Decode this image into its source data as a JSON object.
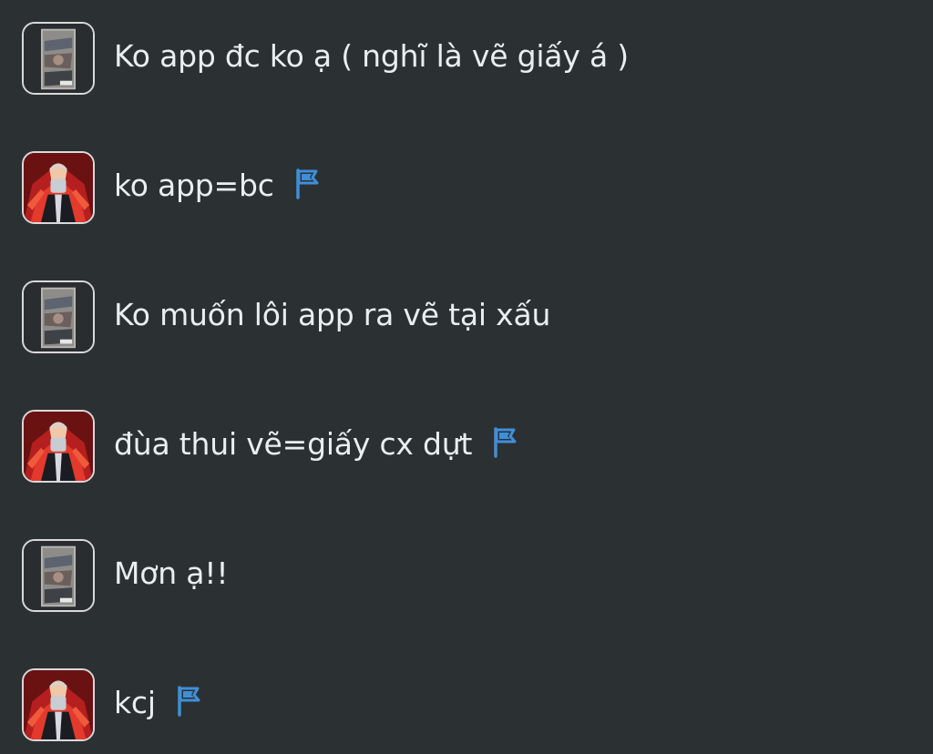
{
  "messages": [
    {
      "author": "user-a",
      "avatar": "sketch-avatar",
      "text": "Ko app đc ko ạ ( nghĩ là vẽ giấy á )",
      "flag": false
    },
    {
      "author": "user-b",
      "avatar": "hero-avatar",
      "text": "ko app=bc",
      "flag": true
    },
    {
      "author": "user-a",
      "avatar": "sketch-avatar",
      "text": "Ko muốn lôi app ra vẽ tại xấu",
      "flag": false
    },
    {
      "author": "user-b",
      "avatar": "hero-avatar",
      "text": "đùa thui vẽ=giấy cx dựt",
      "flag": true
    },
    {
      "author": "user-a",
      "avatar": "sketch-avatar",
      "text": "Mơn ạ!!",
      "flag": false
    },
    {
      "author": "user-b",
      "avatar": "hero-avatar",
      "text": "kcj",
      "flag": true
    }
  ],
  "colors": {
    "background": "#2b3033",
    "text": "#e9eef0",
    "flag": "#3f8fd8",
    "avatar_border": "#d9d9d9"
  },
  "icons": {
    "flag": "flag-icon"
  }
}
